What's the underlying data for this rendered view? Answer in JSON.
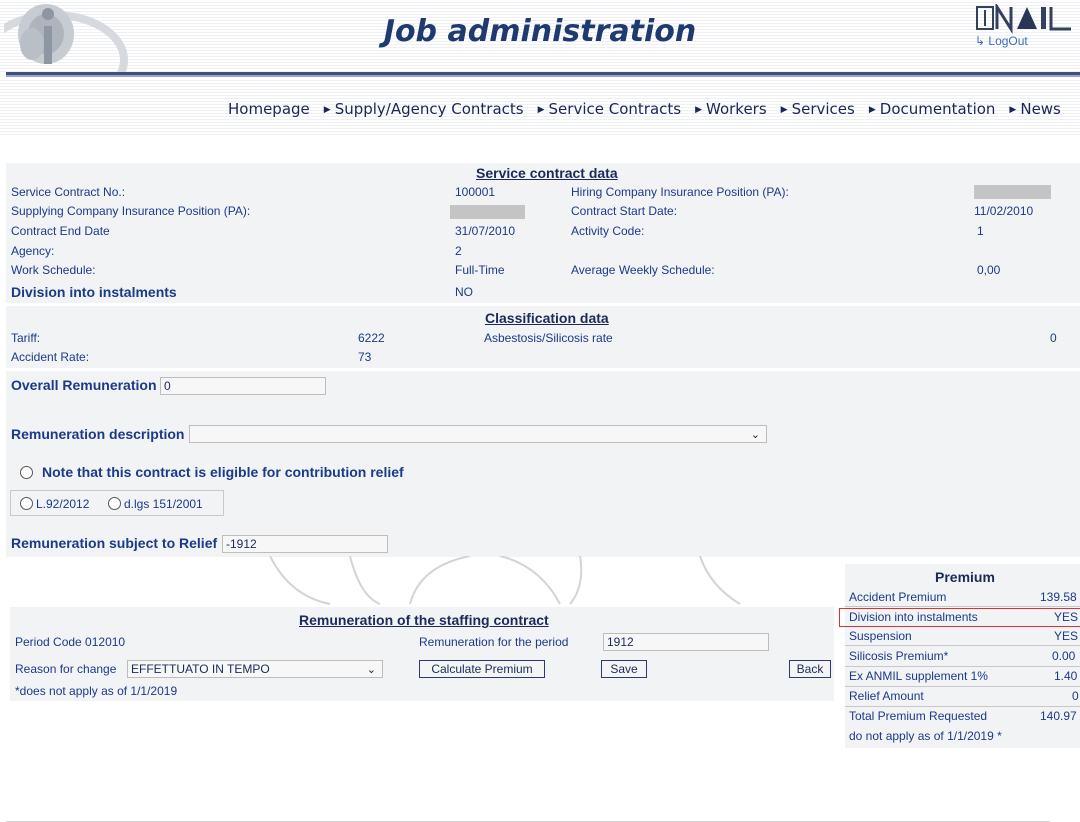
{
  "header": {
    "title": "Job administration",
    "logout": "LogOut",
    "brand": "INAIL"
  },
  "nav": [
    {
      "label": "Homepage"
    },
    {
      "label": "Supply/Agency Contracts"
    },
    {
      "label": "Service Contracts"
    },
    {
      "label": "Workers"
    },
    {
      "label": "Services"
    },
    {
      "label": "Documentation"
    },
    {
      "label": "News"
    }
  ],
  "service": {
    "title": "Service contract data",
    "contract_no_label": "Service Contract No.:",
    "contract_no": "100001",
    "hiring_pa_label": "Hiring Company Insurance Position (PA):",
    "supplying_pa_label": "Supplying Company Insurance Position (PA):",
    "start_date_label": "Contract Start Date:",
    "start_date": "11/02/2010",
    "end_date_label": "Contract End Date",
    "end_date": "31/07/2010",
    "activity_code_label": "Activity Code:",
    "activity_code": "1",
    "agency_label": "Agency:",
    "agency": "2",
    "schedule_label": "Work Schedule:",
    "schedule": "Full-Time",
    "avg_weekly_label": "Average Weekly Schedule:",
    "avg_weekly": "0,00",
    "division_label": "Division into instalments",
    "division": "NO"
  },
  "classification": {
    "title": "Classification data",
    "tariff_label": "Tariff:",
    "tariff": "6222",
    "asbestosis_label": "Asbestosis/Silicosis rate",
    "asbestosis": "0",
    "accident_rate_label": "Accident Rate:",
    "accident_rate": "73"
  },
  "remuneration": {
    "overall_label": "Overall Remuneration",
    "overall_value": "0",
    "description_label": "Remuneration description",
    "description_value": "",
    "eligible_label": "Note that this contract is eligible for contribution relief",
    "law1": "L.92/2012",
    "law2": "d.lgs 151/2001",
    "relief_label": "Remuneration subject to Relief",
    "relief_value": "-1912"
  },
  "staffing": {
    "title": "Remuneration of the staffing contract",
    "period_code": "Period Code 012010",
    "period_rem_label": "Remuneration for the period",
    "period_rem_value": "1912",
    "reason_label": "Reason for change",
    "reason_value": "EFFETTUATO IN TEMPO",
    "calc_button": "Calculate Premium",
    "save_button": "Save",
    "back_button": "Back",
    "note": "*does not apply as of 1/1/2019"
  },
  "premium": {
    "title": "Premium",
    "rows": [
      {
        "label": "Accident Premium",
        "value": "139.58"
      },
      {
        "label": "Division into instalments",
        "value": "YES"
      },
      {
        "label": "Suspension",
        "value": "YES"
      },
      {
        "label": "Silicosis Premium*",
        "value": "0.00"
      },
      {
        "label": "Ex ANMIL supplement 1%",
        "value": "1.40"
      },
      {
        "label": "Relief Amount",
        "value": "0"
      },
      {
        "label": "Total Premium Requested",
        "value": "140.97"
      }
    ],
    "footnote": "do not apply as of 1/1/2019 *",
    "highlight_color": "#e03030"
  }
}
